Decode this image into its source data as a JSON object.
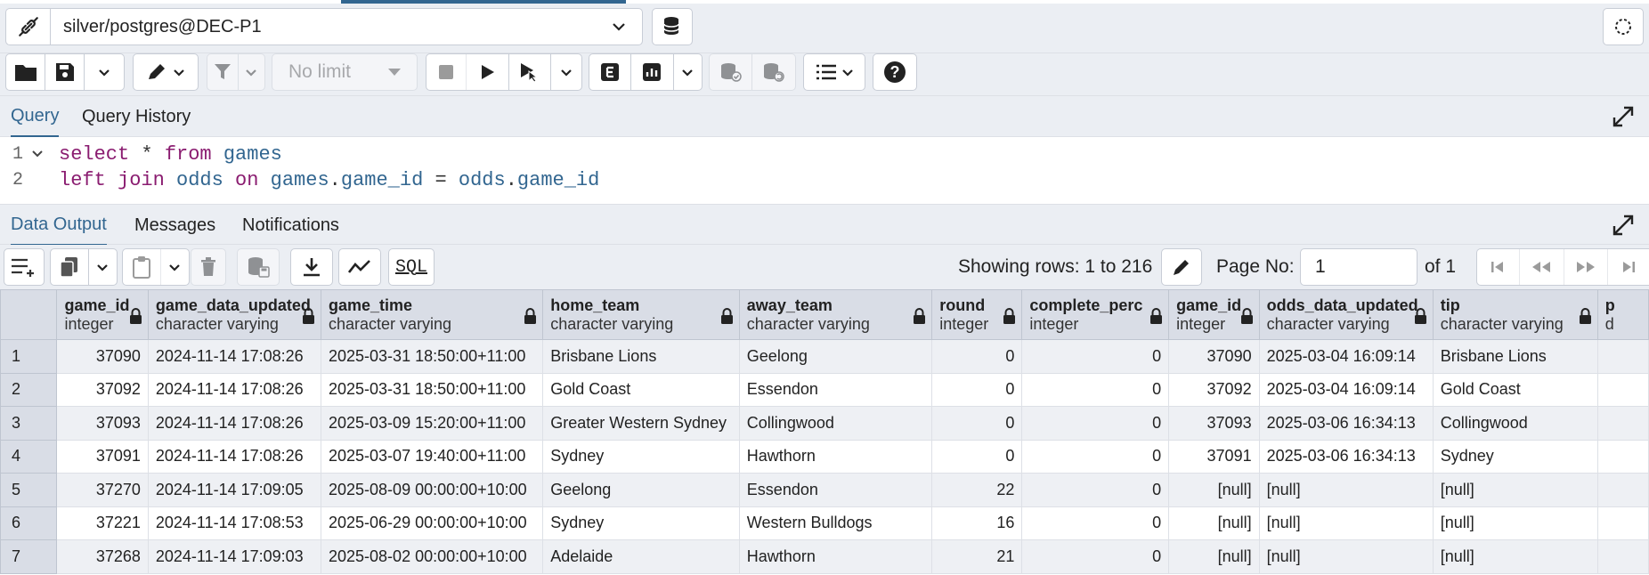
{
  "connection": {
    "label": "silver/postgres@DEC-P1"
  },
  "toolbar": {
    "limit_label": "No limit"
  },
  "query_tabs": [
    {
      "label": "Query",
      "active": true
    },
    {
      "label": "Query History",
      "active": false
    }
  ],
  "editor": {
    "lines": [
      {
        "number": "1",
        "text": "select * from games"
      },
      {
        "number": "2",
        "text": "left join odds on games.game_id = odds.game_id"
      }
    ]
  },
  "output_tabs": [
    {
      "label": "Data Output",
      "active": true
    },
    {
      "label": "Messages",
      "active": false
    },
    {
      "label": "Notifications",
      "active": false
    }
  ],
  "data_toolbar": {
    "sql_label": "SQL",
    "rows_info": "Showing rows: 1 to 216",
    "page_label": "Page No:",
    "page_value": "1",
    "page_of": "of 1"
  },
  "grid": {
    "columns": [
      {
        "name": "game_id",
        "type": "integer"
      },
      {
        "name": "game_data_updated",
        "type": "character varying"
      },
      {
        "name": "game_time",
        "type": "character varying"
      },
      {
        "name": "home_team",
        "type": "character varying"
      },
      {
        "name": "away_team",
        "type": "character varying"
      },
      {
        "name": "round",
        "type": "integer"
      },
      {
        "name": "complete_perc",
        "type": "integer"
      },
      {
        "name": "game_id",
        "type": "integer"
      },
      {
        "name": "odds_data_updated",
        "type": "character varying"
      },
      {
        "name": "tip",
        "type": "character varying"
      },
      {
        "name": "p",
        "type": "d"
      }
    ],
    "rows": [
      {
        "n": "1",
        "cells": [
          "37090",
          "2024-11-14 17:08:26",
          "2025-03-31 18:50:00+11:00",
          "Brisbane Lions",
          "Geelong",
          "0",
          "0",
          "37090",
          "2025-03-04 16:09:14",
          "Brisbane Lions",
          ""
        ]
      },
      {
        "n": "2",
        "cells": [
          "37092",
          "2024-11-14 17:08:26",
          "2025-03-31 18:50:00+11:00",
          "Gold Coast",
          "Essendon",
          "0",
          "0",
          "37092",
          "2025-03-04 16:09:14",
          "Gold Coast",
          ""
        ]
      },
      {
        "n": "3",
        "cells": [
          "37093",
          "2024-11-14 17:08:26",
          "2025-03-09 15:20:00+11:00",
          "Greater Western Sydney",
          "Collingwood",
          "0",
          "0",
          "37093",
          "2025-03-06 16:34:13",
          "Collingwood",
          ""
        ]
      },
      {
        "n": "4",
        "cells": [
          "37091",
          "2024-11-14 17:08:26",
          "2025-03-07 19:40:00+11:00",
          "Sydney",
          "Hawthorn",
          "0",
          "0",
          "37091",
          "2025-03-06 16:34:13",
          "Sydney",
          ""
        ]
      },
      {
        "n": "5",
        "cells": [
          "37270",
          "2024-11-14 17:09:05",
          "2025-08-09 00:00:00+10:00",
          "Geelong",
          "Essendon",
          "22",
          "0",
          "[null]",
          "[null]",
          "[null]",
          ""
        ]
      },
      {
        "n": "6",
        "cells": [
          "37221",
          "2024-11-14 17:08:53",
          "2025-06-29 00:00:00+10:00",
          "Sydney",
          "Western Bulldogs",
          "16",
          "0",
          "[null]",
          "[null]",
          "[null]",
          ""
        ]
      },
      {
        "n": "7",
        "cells": [
          "37268",
          "2024-11-14 17:09:03",
          "2025-08-02 00:00:00+10:00",
          "Adelaide",
          "Hawthorn",
          "21",
          "0",
          "[null]",
          "[null]",
          "[null]",
          ""
        ]
      }
    ]
  }
}
